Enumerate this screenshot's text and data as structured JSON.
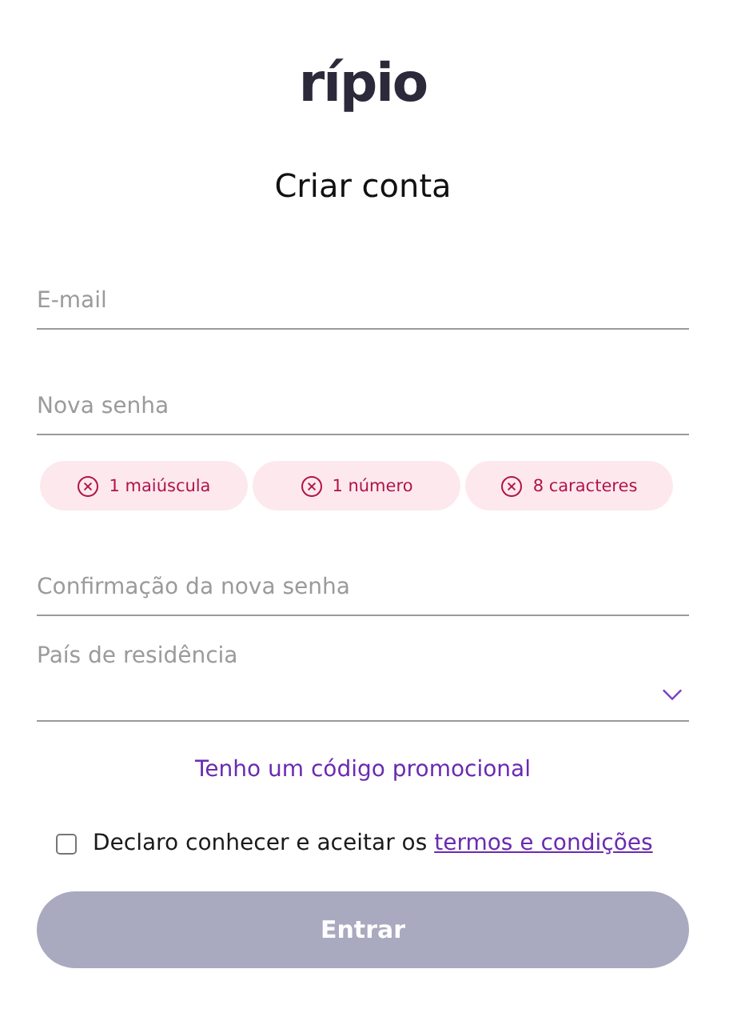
{
  "logo": "rípio",
  "title": "Criar conta",
  "fields": [
    {
      "placeholder": "E-mail"
    },
    {
      "placeholder": "Nova senha"
    }
  ],
  "requirements": [
    {
      "label": "1 maiúscula",
      "met": false
    },
    {
      "label": "1 número",
      "met": false
    },
    {
      "label": "8 caracteres",
      "met": false
    }
  ],
  "fields_2": [
    {
      "kind": "input",
      "placeholder": "Confirmação da nova senha"
    },
    {
      "kind": "select",
      "placeholder": "País de residência"
    }
  ],
  "promo_link": "Tenho um código promocional",
  "terms": {
    "checked": false,
    "text": "Declaro conhecer e aceitar os ",
    "link": "termos e condições"
  },
  "submit": {
    "label": "Entrar",
    "disabled": true
  }
}
